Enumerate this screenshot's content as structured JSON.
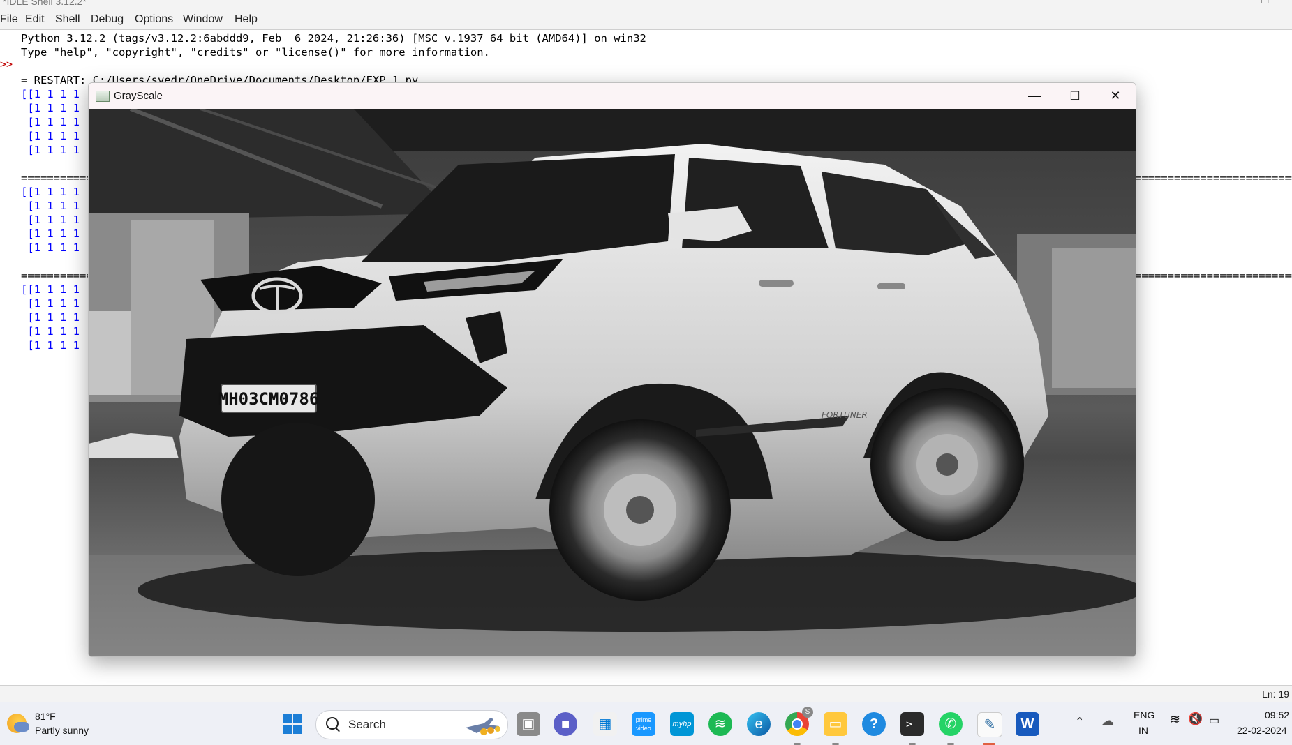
{
  "idle": {
    "window_title": "*IDLE Shell 3.12.2*",
    "menu": [
      "File",
      "Edit",
      "Shell",
      "Debug",
      "Options",
      "Window",
      "Help"
    ],
    "prompt": ">>",
    "banner_line1": "Python 3.12.2 (tags/v3.12.2:6abddd9, Feb  6 2024, 21:26:36) [MSC v.1937 64 bit (AMD64)] on win32",
    "banner_line2": "Type \"help\", \"copyright\", \"credits\" or \"license()\" for more information.",
    "restart_line": "= RESTART: C:/Users/svedr/OneDrive/Documents/Desktop/EXP 1.py",
    "output_block1": [
      "[[1 1 1 1",
      " [1 1 1 1",
      " [1 1 1 1",
      " [1 1 1 1",
      " [1 1 1 1"
    ],
    "output_block2": [
      "[[1 1 1 1",
      " [1 1 1 1",
      " [1 1 1 1",
      " [1 1 1 1",
      " [1 1 1 1"
    ],
    "output_block3": [
      "[[1 1 1 1",
      " [1 1 1 1",
      " [1 1 1 1",
      " [1 1 1 1",
      " [1 1 1 1"
    ],
    "separator": "===================================",
    "separator_right": "==================================",
    "status": "Ln: 19"
  },
  "grayscale_window": {
    "title": "GrayScale",
    "minimize": "—",
    "maximize": "☐",
    "close": "✕",
    "plate_text": "MH03CM0786",
    "badge_text": "FORTUNER"
  },
  "taskbar": {
    "temperature": "81°F",
    "condition": "Partly sunny",
    "search_label": "Search",
    "language_top": "ENG",
    "language_bottom": "IN",
    "time": "09:52",
    "date": "22-02-2024",
    "chrome_badge": "S",
    "word_letter": "W"
  }
}
